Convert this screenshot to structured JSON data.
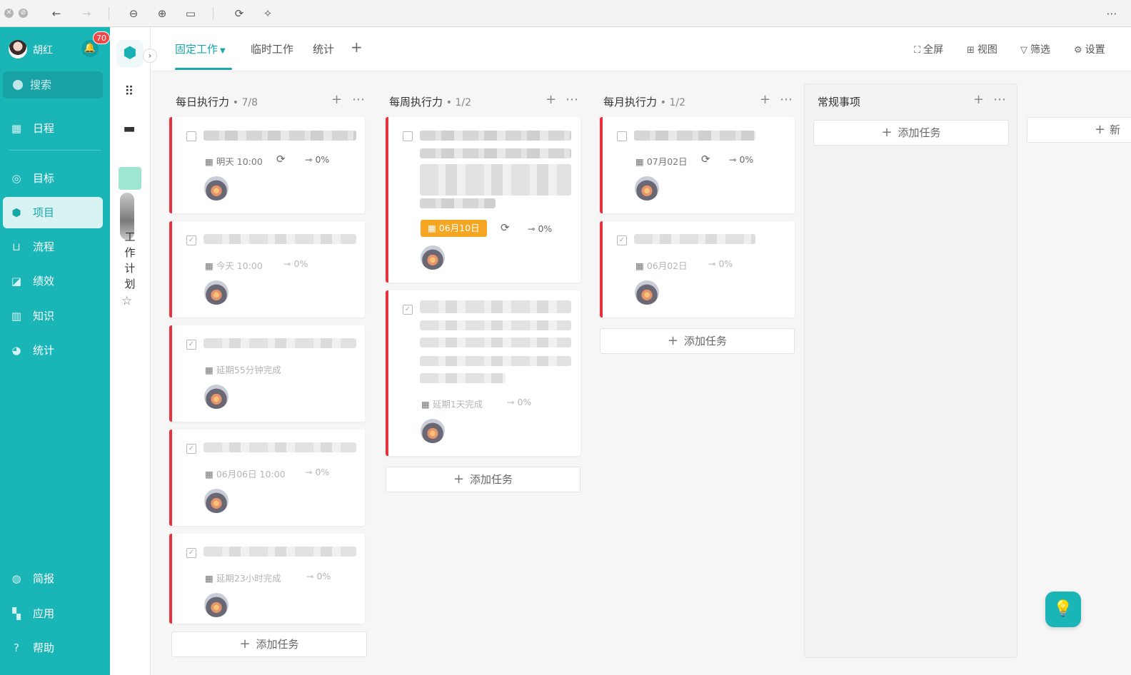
{
  "user": {
    "name": "胡红",
    "notification_count": "70"
  },
  "sidebar": {
    "search_placeholder": "搜索",
    "items": [
      {
        "label": "日程",
        "icon": "calendar-icon"
      },
      {
        "label": "目标",
        "icon": "target-icon"
      },
      {
        "label": "项目",
        "icon": "cube-icon",
        "active": true
      },
      {
        "label": "流程",
        "icon": "flow-icon"
      },
      {
        "label": "绩效",
        "icon": "chart-icon"
      },
      {
        "label": "知识",
        "icon": "book-icon"
      },
      {
        "label": "统计",
        "icon": "pie-icon"
      }
    ],
    "bottom_items": [
      {
        "label": "简报",
        "icon": "report-icon"
      },
      {
        "label": "应用",
        "icon": "apps-icon"
      },
      {
        "label": "帮助",
        "icon": "help-icon"
      }
    ]
  },
  "project": {
    "name_vertical": "工作计划"
  },
  "header": {
    "tabs": [
      "固定工作",
      "临时工作",
      "统计"
    ],
    "active_tab": "固定工作",
    "actions": [
      "全屏",
      "视图",
      "筛选",
      "设置"
    ]
  },
  "colors": {
    "accent": "#1ab5b7",
    "priority": "#e8313d",
    "due": "#f5a623"
  },
  "columns": [
    {
      "title": "每日执行力",
      "count": "• 7/8",
      "cards": [
        {
          "checked": false,
          "date": "明天 10:00",
          "repeat": true,
          "progress": "0%",
          "faded": false
        },
        {
          "checked": true,
          "date": "今天 10:00",
          "repeat": false,
          "progress": "0%",
          "faded": true
        },
        {
          "checked": true,
          "date": "延期55分钟完成",
          "repeat": false,
          "progress": "",
          "faded": true
        },
        {
          "checked": true,
          "date": "06月06日 10:00",
          "repeat": false,
          "progress": "0%",
          "faded": true
        },
        {
          "checked": true,
          "date": "延期23小时完成",
          "repeat": false,
          "progress": "0%",
          "faded": true
        }
      ]
    },
    {
      "title": "每周执行力",
      "count": "• 1/2",
      "cards": [
        {
          "checked": false,
          "date": "06月10日",
          "repeat": true,
          "progress": "0%",
          "faded": false,
          "due_highlight": true
        },
        {
          "checked": true,
          "date": "延期1天完成",
          "repeat": false,
          "progress": "0%",
          "faded": true
        }
      ]
    },
    {
      "title": "每月执行力",
      "count": "• 1/2",
      "cards": [
        {
          "checked": false,
          "date": "07月02日",
          "repeat": true,
          "progress": "0%",
          "faded": false
        },
        {
          "checked": true,
          "date": "06月02日",
          "repeat": false,
          "progress": "0%",
          "faded": true
        }
      ]
    },
    {
      "title": "常规事项",
      "count": "",
      "cards": []
    }
  ],
  "add_task_label": "添加任务",
  "new_column_label": "新"
}
